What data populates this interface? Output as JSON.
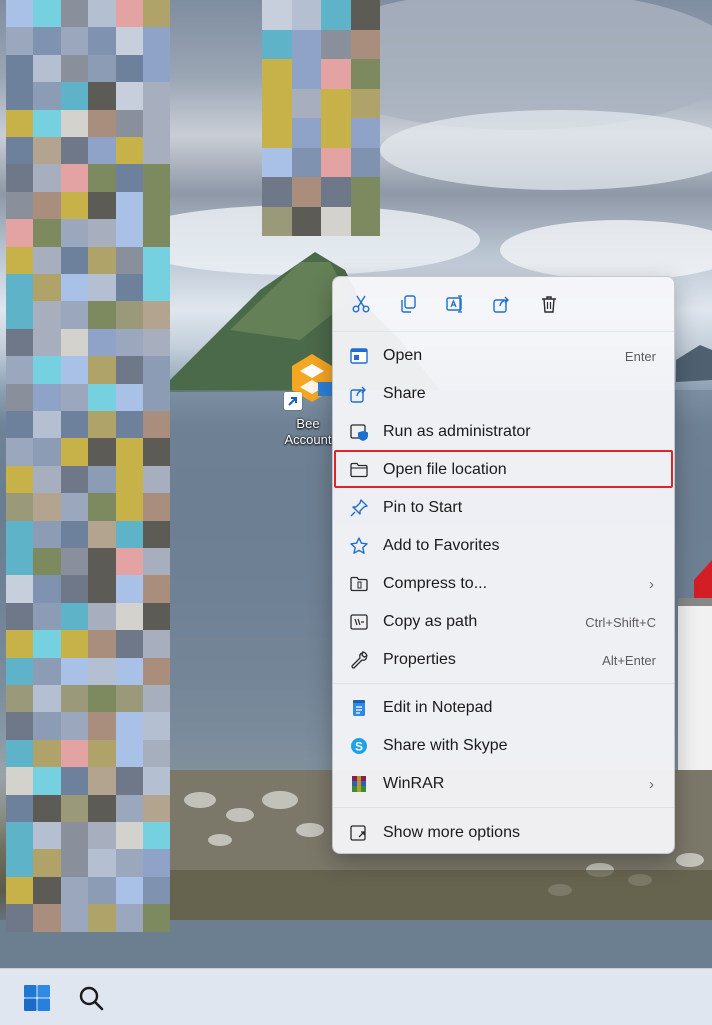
{
  "desktop": {
    "shortcut": {
      "label": "Bee Account"
    }
  },
  "context_menu": {
    "quick_actions": [
      {
        "name": "cut",
        "icon": "scissors-icon"
      },
      {
        "name": "copy",
        "icon": "copy-icon"
      },
      {
        "name": "rename",
        "icon": "rename-icon"
      },
      {
        "name": "share",
        "icon": "share-icon"
      },
      {
        "name": "delete",
        "icon": "trash-icon"
      }
    ],
    "items": [
      {
        "label": "Open",
        "shortcut": "Enter",
        "icon": "app-window-icon"
      },
      {
        "label": "Share",
        "shortcut": "",
        "icon": "share-icon"
      },
      {
        "label": "Run as administrator",
        "shortcut": "",
        "icon": "shield-window-icon"
      },
      {
        "label": "Open file location",
        "shortcut": "",
        "icon": "folder-icon",
        "highlighted": true
      },
      {
        "label": "Pin to Start",
        "shortcut": "",
        "icon": "pin-icon"
      },
      {
        "label": "Add to Favorites",
        "shortcut": "",
        "icon": "star-icon"
      },
      {
        "label": "Compress to...",
        "shortcut": "",
        "icon": "zip-folder-icon",
        "submenu": true
      },
      {
        "label": "Copy as path",
        "shortcut": "Ctrl+Shift+C",
        "icon": "copy-path-icon"
      },
      {
        "label": "Properties",
        "shortcut": "Alt+Enter",
        "icon": "wrench-icon"
      },
      {
        "label": "Edit in Notepad",
        "shortcut": "",
        "icon": "notepad-icon"
      },
      {
        "label": "Share with Skype",
        "shortcut": "",
        "icon": "skype-icon"
      },
      {
        "label": "WinRAR",
        "shortcut": "",
        "icon": "winrar-icon",
        "submenu": true
      },
      {
        "label": "Show more options",
        "shortcut": "",
        "icon": "more-options-icon"
      }
    ],
    "submenu_glyph": "›",
    "highlight_color": "#d9262a"
  },
  "taskbar": {
    "items": [
      {
        "name": "start",
        "icon": "windows-logo-icon"
      },
      {
        "name": "search",
        "icon": "search-icon"
      }
    ]
  }
}
